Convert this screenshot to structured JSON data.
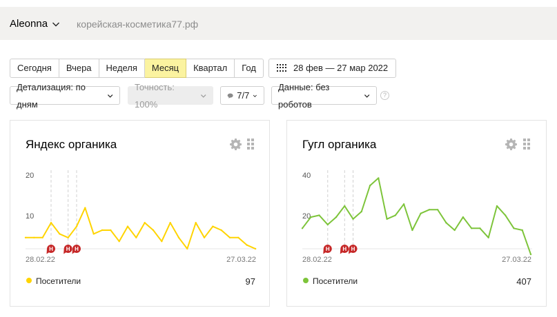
{
  "header": {
    "account": "Aleonna",
    "domain": "корейская-косметика77.рф"
  },
  "periods": [
    {
      "label": "Сегодня",
      "active": false
    },
    {
      "label": "Вчера",
      "active": false
    },
    {
      "label": "Неделя",
      "active": false
    },
    {
      "label": "Месяц",
      "active": true
    },
    {
      "label": "Квартал",
      "active": false
    },
    {
      "label": "Год",
      "active": false
    }
  ],
  "date_range": "28 фев — 27 мар 2022",
  "controls": {
    "detail": "Детализация: по дням",
    "accuracy": "Точность: 100%",
    "segments": "7/7",
    "data": "Данные: без роботов",
    "help": "?"
  },
  "colors": {
    "active_period": "#fbf3a0",
    "yandex_series": "#ffd400",
    "google_series": "#7dc43a",
    "annotation": "#c62828"
  },
  "chart_data": [
    {
      "type": "line",
      "title": "Яндекс органика",
      "x": [
        "28.02.22",
        "01.03.22",
        "02.03.22",
        "03.03.22",
        "04.03.22",
        "05.03.22",
        "06.03.22",
        "07.03.22",
        "08.03.22",
        "09.03.22",
        "10.03.22",
        "11.03.22",
        "12.03.22",
        "13.03.22",
        "14.03.22",
        "15.03.22",
        "16.03.22",
        "17.03.22",
        "18.03.22",
        "19.03.22",
        "20.03.22",
        "21.03.22",
        "22.03.22",
        "23.03.22",
        "24.03.22",
        "25.03.22",
        "26.03.22",
        "27.03.22"
      ],
      "x_tick_labels": [
        "28.02.22",
        "27.03.22"
      ],
      "series": [
        {
          "name": "Посетители",
          "total": "97",
          "values": [
            3,
            3,
            3,
            7,
            4,
            3,
            6,
            11,
            4,
            5,
            5,
            2,
            6,
            3,
            7,
            5,
            2,
            7,
            3,
            0,
            7,
            3,
            6,
            5,
            3,
            3,
            1,
            0
          ]
        }
      ],
      "y_ticks": [
        "10",
        "20"
      ],
      "ylim": [
        0,
        20
      ],
      "annotations": [
        {
          "x": "03.03.22",
          "label": "Н"
        },
        {
          "x": "05.03.22",
          "label": "Н"
        },
        {
          "x": "06.03.22",
          "label": "Н"
        }
      ],
      "grid": false
    },
    {
      "type": "line",
      "title": "Гугл органика",
      "x": [
        "28.02.22",
        "01.03.22",
        "02.03.22",
        "03.03.22",
        "04.03.22",
        "05.03.22",
        "06.03.22",
        "07.03.22",
        "08.03.22",
        "09.03.22",
        "10.03.22",
        "11.03.22",
        "12.03.22",
        "13.03.22",
        "14.03.22",
        "15.03.22",
        "16.03.22",
        "17.03.22",
        "18.03.22",
        "19.03.22",
        "20.03.22",
        "21.03.22",
        "22.03.22",
        "23.03.22",
        "24.03.22",
        "25.03.22",
        "26.03.22",
        "27.03.22"
      ],
      "x_tick_labels": [
        "28.02.22",
        "27.03.22"
      ],
      "series": [
        {
          "name": "Посетители",
          "total": "407",
          "values": [
            11,
            17,
            18,
            13,
            17,
            23,
            16,
            20,
            34,
            38,
            16,
            18,
            24,
            10,
            19,
            21,
            21,
            14,
            10,
            17,
            11,
            11,
            6,
            23,
            18,
            11,
            10,
            -3
          ]
        }
      ],
      "y_ticks": [
        "20",
        "40"
      ],
      "ylim": [
        0,
        40
      ],
      "annotations": [
        {
          "x": "03.03.22",
          "label": "Н"
        },
        {
          "x": "05.03.22",
          "label": "Н"
        },
        {
          "x": "06.03.22",
          "label": "Н"
        }
      ],
      "grid": false
    }
  ]
}
